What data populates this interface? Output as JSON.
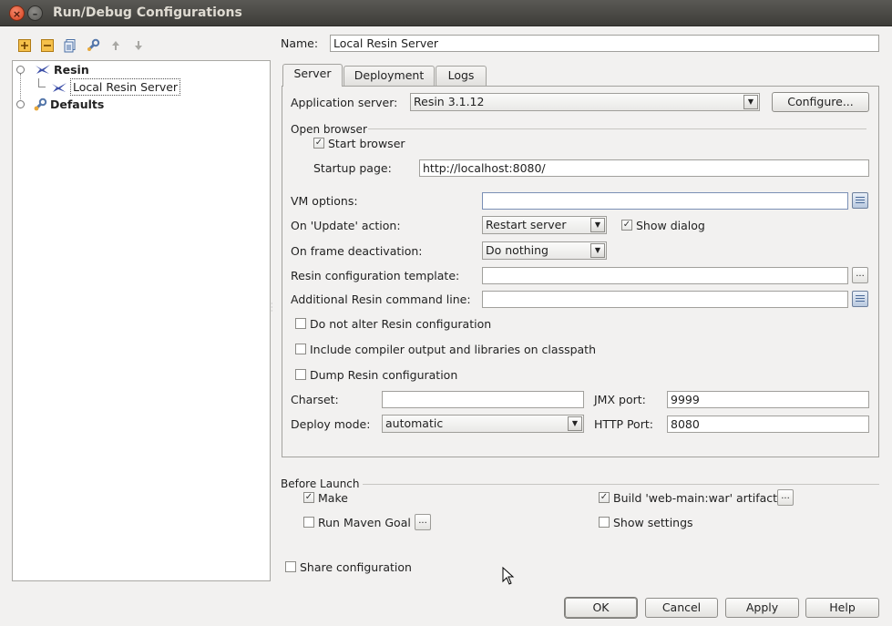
{
  "window": {
    "title": "Run/Debug Configurations",
    "close_glyph": "×",
    "min_glyph": "–"
  },
  "toolbar_icons": [
    "add-icon",
    "remove-icon",
    "copy-icon",
    "wrench-icon",
    "arrow-up-icon",
    "arrow-down-icon"
  ],
  "tree": {
    "items": [
      {
        "label": "Resin",
        "bold": true
      },
      {
        "label": "Local Resin Server",
        "selected": true
      },
      {
        "label": "Defaults",
        "bold": true
      }
    ]
  },
  "name_field": {
    "label": "Name:",
    "value": "Local Resin Server"
  },
  "tabs": [
    {
      "label": "Server",
      "active": true
    },
    {
      "label": "Deployment"
    },
    {
      "label": "Logs"
    }
  ],
  "server": {
    "app_server_label": "Application server:",
    "app_server_value": "Resin 3.1.12",
    "configure_label": "Configure...",
    "open_browser_title": "Open browser",
    "start_browser_label": "Start browser",
    "start_browser_checked": true,
    "startup_page_label": "Startup page:",
    "startup_page_value": "http://localhost:8080/",
    "vm_options_label": "VM options:",
    "vm_options_value": "",
    "on_update_label": "On 'Update' action:",
    "on_update_value": "Restart server",
    "show_dialog_label": "Show dialog",
    "show_dialog_checked": true,
    "on_frame_label": "On frame deactivation:",
    "on_frame_value": "Do nothing",
    "template_label": "Resin configuration template:",
    "template_value": "",
    "cmdline_label": "Additional Resin command line:",
    "cmdline_value": "",
    "do_not_alter_label": "Do not alter Resin configuration",
    "include_compiler_label": "Include compiler output and libraries on classpath",
    "dump_label": "Dump Resin configuration",
    "charset_label": "Charset:",
    "charset_value": "",
    "jmx_label": "JMX port:",
    "jmx_value": "9999",
    "deploy_mode_label": "Deploy mode:",
    "deploy_mode_value": "automatic",
    "http_label": "HTTP Port:",
    "http_value": "8080"
  },
  "before_launch": {
    "title": "Before Launch",
    "make_label": "Make",
    "make_checked": true,
    "build_label": "Build 'web-main:war' artifact",
    "build_checked": true,
    "maven_label": "Run Maven Goal",
    "maven_checked": false,
    "show_settings_label": "Show settings",
    "show_settings_checked": false
  },
  "share_label": "Share configuration",
  "share_checked": false,
  "ellipsis": "...",
  "check_glyph": "✓",
  "arrow_glyph": "▼",
  "buttons": {
    "ok": "OK",
    "cancel": "Cancel",
    "apply": "Apply",
    "help": "Help"
  }
}
